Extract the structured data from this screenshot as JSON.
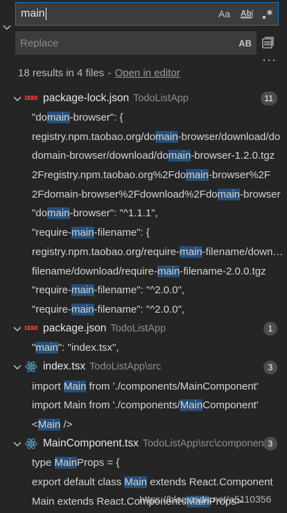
{
  "search": {
    "value": "main",
    "options": [
      "Aa",
      "Ab|",
      ".*"
    ]
  },
  "replace": {
    "placeholder": "Replace",
    "preserve_case": "AB"
  },
  "summary": {
    "text": "18 results in 4 files",
    "separator": " - ",
    "open_in_editor": "Open in editor"
  },
  "files": [
    {
      "name": "package-lock.json",
      "path": "TodoListApp",
      "count": "11",
      "icon": "npm-icon",
      "matches": [
        {
          "pre": "\"do",
          "hit": "main",
          "post": "-browser\": {"
        },
        {
          "pre": "registry.npm.taobao.org/do",
          "hit": "main",
          "post": "-browser/download/do"
        },
        {
          "pre": "domain-browser/download/do",
          "hit": "main",
          "post": "-browser-1.2.0.tgz"
        },
        {
          "pre": "2Fregistry.npm.taobao.org%2Fdo",
          "hit": "main",
          "post": "-browser%2F"
        },
        {
          "pre": "2Fdomain-browser%2Fdownload%2Fdo",
          "hit": "main",
          "post": "-browser"
        },
        {
          "pre": "\"do",
          "hit": "main",
          "post": "-browser\": \"^1.1.1\","
        },
        {
          "pre": "\"require-",
          "hit": "main",
          "post": "-filename\": {"
        },
        {
          "pre": "registry.npm.taobao.org/require-",
          "hit": "main",
          "post": "-filename/download"
        },
        {
          "pre": "filename/download/require-",
          "hit": "main",
          "post": "-filename-2.0.0.tgz"
        },
        {
          "pre": "\"require-",
          "hit": "main",
          "post": "-filename\": \"^2.0.0\","
        },
        {
          "pre": "\"require-",
          "hit": "main",
          "post": "-filename\": \"^2.0.0\","
        }
      ]
    },
    {
      "name": "package.json",
      "path": "TodoListApp",
      "count": "1",
      "icon": "npm-icon",
      "matches": [
        {
          "pre": "\"",
          "hit": "main",
          "post": "\": \"index.tsx\","
        }
      ]
    },
    {
      "name": "index.tsx",
      "path": "TodoListApp\\src",
      "count": "3",
      "icon": "react-icon",
      "matches": [
        {
          "pre": "import ",
          "hit": "Main",
          "post": " from './components/MainComponent'"
        },
        {
          "pre": "import Main from './components/",
          "hit": "Main",
          "post": "Component'"
        },
        {
          "pre": "<",
          "hit": "Main",
          "post": " />"
        }
      ]
    },
    {
      "name": "MainComponent.tsx",
      "path": "TodoListApp\\src\\components",
      "count": "3",
      "icon": "react-icon",
      "matches": [
        {
          "pre": "type ",
          "hit": "Main",
          "post": "Props = {"
        },
        {
          "pre": "export default class ",
          "hit": "Main",
          "post": " extends React.Component"
        },
        {
          "pre": "Main extends React.Component<",
          "hit": "Main",
          "post": "Props>"
        }
      ]
    }
  ],
  "watermark": "https://blog.csdn.net/a5110356",
  "colors": {
    "background": "#252526",
    "input": "#3c3c3c",
    "focus_border": "#007fd4",
    "match_highlight": "#264f78",
    "badge": "#4d4d4d",
    "npm_red": "#cb3837",
    "react_blue": "#519aba"
  }
}
